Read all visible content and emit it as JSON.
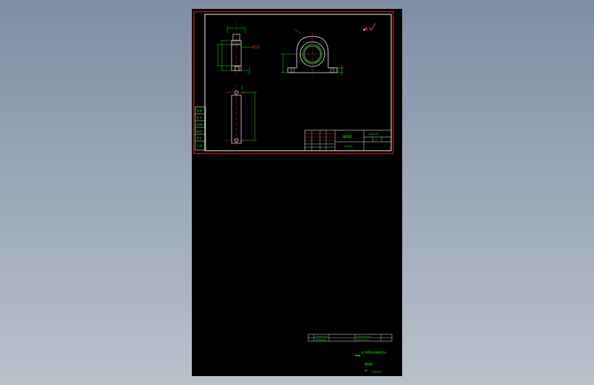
{
  "colors": {
    "viewport_background_top": "#7e8ea2",
    "viewport_background_bottom": "#b9c1cb",
    "sheet_background": "#000000",
    "frame_outer": "#ff2a2a",
    "frame_inner": "#ffffff",
    "dimension_lines": "#00ff00",
    "text": "#00ff00",
    "center_lines": "#ff2a2a",
    "roughness_mark": "#ff3b3b"
  },
  "icons": {
    "roughness": "surface-roughness-icon"
  },
  "drawing": {
    "title_block": {
      "drawing_number": "GZ-B-05",
      "part_name": "轴承座",
      "material": "HT200",
      "scale_label": "1:1"
    },
    "side_block_labels": [
      "描 图",
      "校 对",
      "旧底图总号",
      "底图总号",
      "签 字",
      "日 期"
    ],
    "bottom_block": {
      "project_title": "矿井提升机系统设计",
      "drawing_type": "装配图",
      "document_number": "JTSJ-00-Z"
    }
  }
}
